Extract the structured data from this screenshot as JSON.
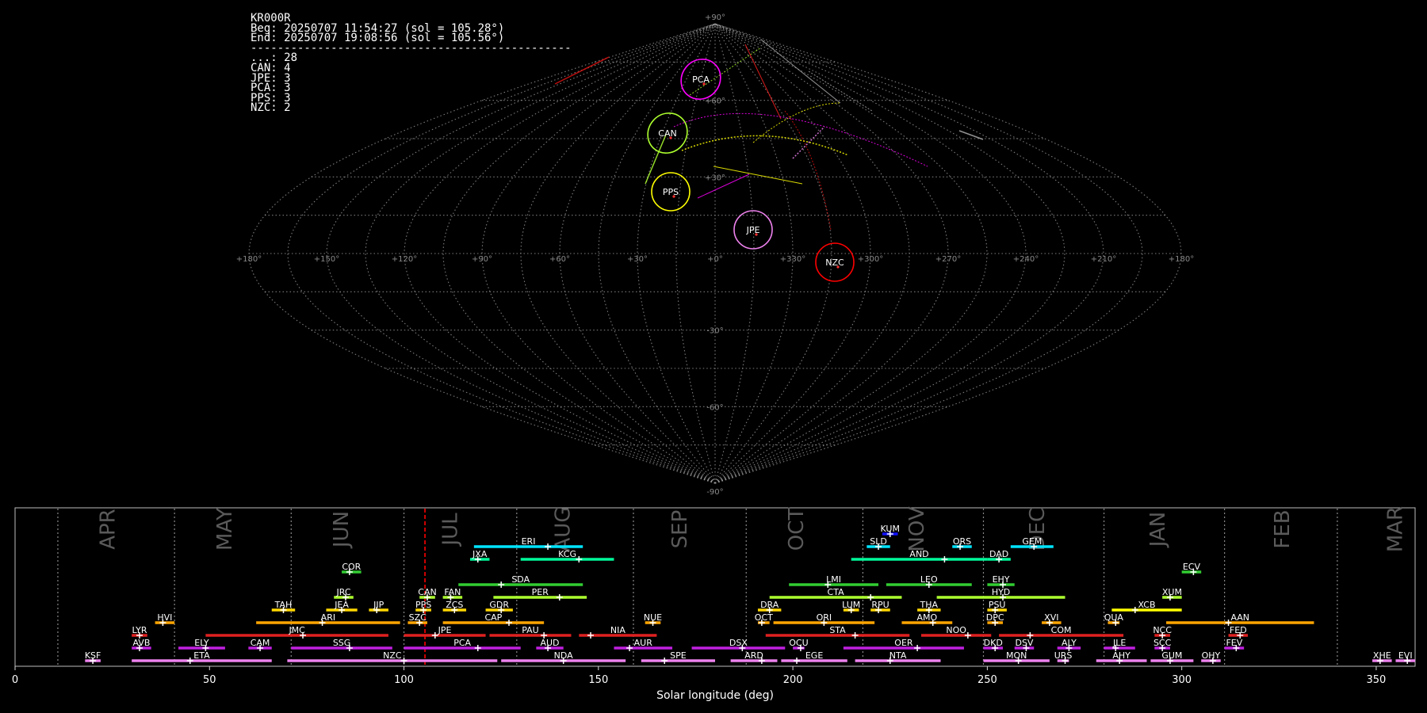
{
  "station_info": {
    "code": "KR000R",
    "beg": "Beg: 20250707 11:54:27 (sol = 105.28°)",
    "end": "End: 20250707 19:08:56 (sol = 105.56°)",
    "separator": "------------------------------------------------",
    "counts": [
      "...: 28",
      "CAN: 4",
      "JPE: 3",
      "PCA: 3",
      "PPS: 3",
      "NZC: 2"
    ]
  },
  "colors": {
    "background": "#000000",
    "grid": "#9a9a9a",
    "current_sol_marker": "#ff0000",
    "CAN": "#adff2f",
    "PCA": "#ff00ff",
    "PPS": "#ffff00",
    "JPE": "#ee82ee",
    "NZC": "#ff0000"
  },
  "skymap": {
    "projection": "sinusoidal",
    "lon_labels": [
      "+180°",
      "+150°",
      "+120°",
      "+90°",
      "+60°",
      "+30°",
      "+0°",
      "+330°",
      "+300°",
      "+270°",
      "+240°",
      "+210°",
      "+180°"
    ],
    "lat_labels": [
      "+90°",
      "+60°",
      "+30°",
      "-30°",
      "-60°",
      "-90°"
    ],
    "lat_values": [
      90,
      60,
      30,
      -30,
      -60,
      -90
    ],
    "showers": [
      {
        "code": "PCA",
        "lon": -5,
        "lat": 63,
        "color": "#ff00ff"
      },
      {
        "code": "CAN",
        "lon": -15,
        "lat": 48,
        "color": "#adff2f"
      },
      {
        "code": "PPS",
        "lon": -18,
        "lat": 31,
        "color": "#ffff00"
      },
      {
        "code": "JPE",
        "lon": -25,
        "lat": 20,
        "color": "#ee82ee"
      },
      {
        "code": "NZC",
        "lon": -63,
        "lat": -3,
        "color": "#ff0000"
      }
    ]
  },
  "chart_data": {
    "type": "timeline",
    "xlabel": "Solar longitude (deg)",
    "xlim": [
      0,
      360
    ],
    "xticks": [
      0,
      50,
      100,
      150,
      200,
      250,
      300,
      350
    ],
    "current_sol": 105.4,
    "month_labels": [
      {
        "label": "APR",
        "x": 24
      },
      {
        "label": "MAY",
        "x": 54
      },
      {
        "label": "JUN",
        "x": 84
      },
      {
        "label": "JUL",
        "x": 112
      },
      {
        "label": "AUG",
        "x": 141
      },
      {
        "label": "SEP",
        "x": 171
      },
      {
        "label": "OCT",
        "x": 201
      },
      {
        "label": "NOV",
        "x": 232
      },
      {
        "label": "DEC",
        "x": 263
      },
      {
        "label": "JAN",
        "x": 294
      },
      {
        "label": "FEB",
        "x": 326
      },
      {
        "label": "MAR",
        "x": 355
      }
    ],
    "month_boundaries": [
      11,
      41,
      71,
      100,
      129,
      159,
      188,
      218,
      249,
      280,
      311,
      340
    ],
    "showers": [
      {
        "code": "KSF",
        "start": 18,
        "end": 22,
        "peak": 20,
        "row": 0,
        "color": "#ee82ee"
      },
      {
        "code": "ETA",
        "start": 30,
        "end": 66,
        "peak": 45,
        "row": 0,
        "color": "#ee82ee"
      },
      {
        "code": "NZC",
        "start": 70,
        "end": 124,
        "peak": 100,
        "row": 0,
        "color": "#ee82ee"
      },
      {
        "code": "NDA",
        "start": 125,
        "end": 157,
        "peak": 141,
        "row": 0,
        "color": "#ee82ee"
      },
      {
        "code": "SPE",
        "start": 161,
        "end": 180,
        "peak": 167,
        "row": 0,
        "color": "#ee82ee"
      },
      {
        "code": "ARD",
        "start": 184,
        "end": 196,
        "peak": 192,
        "row": 0,
        "color": "#ee82ee"
      },
      {
        "code": "EGE",
        "start": 197,
        "end": 214,
        "peak": 201,
        "row": 0,
        "color": "#ee82ee"
      },
      {
        "code": "NTA",
        "start": 216,
        "end": 238,
        "peak": 225,
        "row": 0,
        "color": "#ee82ee"
      },
      {
        "code": "MON",
        "start": 249,
        "end": 266,
        "peak": 258,
        "row": 0,
        "color": "#ee82ee"
      },
      {
        "code": "URS",
        "start": 268,
        "end": 271,
        "peak": 270,
        "row": 0,
        "color": "#ee82ee"
      },
      {
        "code": "AHY",
        "start": 278,
        "end": 291,
        "peak": 284,
        "row": 0,
        "color": "#ee82ee"
      },
      {
        "code": "GUM",
        "start": 292,
        "end": 303,
        "peak": 297,
        "row": 0,
        "color": "#ee82ee"
      },
      {
        "code": "OHY",
        "start": 305,
        "end": 310,
        "peak": 308,
        "row": 0,
        "color": "#ee82ee"
      },
      {
        "code": "XHE",
        "start": 349,
        "end": 354,
        "peak": 351,
        "row": 0,
        "color": "#ee82ee"
      },
      {
        "code": "EVI",
        "start": 355,
        "end": 360,
        "peak": 358,
        "row": 0,
        "color": "#ee82ee"
      },
      {
        "code": "AVB",
        "start": 30,
        "end": 35,
        "peak": 32,
        "row": 1,
        "color": "#c020e0"
      },
      {
        "code": "ELY",
        "start": 42,
        "end": 54,
        "peak": 49,
        "row": 1,
        "color": "#c020e0"
      },
      {
        "code": "CAM",
        "start": 60,
        "end": 66,
        "peak": 63,
        "row": 1,
        "color": "#c020e0"
      },
      {
        "code": "SSG",
        "start": 71,
        "end": 97,
        "peak": 86,
        "row": 1,
        "color": "#c020e0"
      },
      {
        "code": "PCA",
        "start": 100,
        "end": 130,
        "peak": 119,
        "row": 1,
        "color": "#c020e0"
      },
      {
        "code": "AUD",
        "start": 134,
        "end": 141,
        "peak": 137,
        "row": 1,
        "color": "#c020e0"
      },
      {
        "code": "AUR",
        "start": 154,
        "end": 169,
        "peak": 158,
        "row": 1,
        "color": "#c020e0"
      },
      {
        "code": "DSX",
        "start": 174,
        "end": 198,
        "peak": 187,
        "row": 1,
        "color": "#c020e0"
      },
      {
        "code": "OCU",
        "start": 200,
        "end": 203,
        "peak": 202,
        "row": 1,
        "color": "#c020e0"
      },
      {
        "code": "OER",
        "start": 213,
        "end": 244,
        "peak": 232,
        "row": 1,
        "color": "#c020e0"
      },
      {
        "code": "DKD",
        "start": 249,
        "end": 254,
        "peak": 252,
        "row": 1,
        "color": "#c020e0"
      },
      {
        "code": "DSV",
        "start": 257,
        "end": 262,
        "peak": 260,
        "row": 1,
        "color": "#c020e0"
      },
      {
        "code": "ALY",
        "start": 268,
        "end": 274,
        "peak": 271,
        "row": 1,
        "color": "#c020e0"
      },
      {
        "code": "JLE",
        "start": 280,
        "end": 288,
        "peak": 283,
        "row": 1,
        "color": "#c020e0"
      },
      {
        "code": "SCC",
        "start": 293,
        "end": 297,
        "peak": 295,
        "row": 1,
        "color": "#c020e0"
      },
      {
        "code": "FEV",
        "start": 311,
        "end": 316,
        "peak": 314,
        "row": 1,
        "color": "#c020e0"
      },
      {
        "code": "LYR",
        "start": 30,
        "end": 34,
        "peak": 32,
        "row": 2,
        "color": "#e02020"
      },
      {
        "code": "JMC",
        "start": 49,
        "end": 96,
        "peak": 74,
        "row": 2,
        "color": "#e02020"
      },
      {
        "code": "JPE",
        "start": 100,
        "end": 121,
        "peak": 108,
        "row": 2,
        "color": "#e02020"
      },
      {
        "code": "PAU",
        "start": 122,
        "end": 143,
        "peak": 136,
        "row": 2,
        "color": "#e02020"
      },
      {
        "code": "NIA",
        "start": 145,
        "end": 165,
        "peak": 148,
        "row": 2,
        "color": "#e02020"
      },
      {
        "code": "STA",
        "start": 193,
        "end": 230,
        "peak": 216,
        "row": 2,
        "color": "#e02020"
      },
      {
        "code": "NOO",
        "start": 233,
        "end": 251,
        "peak": 245,
        "row": 2,
        "color": "#e02020"
      },
      {
        "code": "COM",
        "start": 253,
        "end": 285,
        "peak": 261,
        "row": 2,
        "color": "#e02020"
      },
      {
        "code": "NCC",
        "start": 293,
        "end": 297,
        "peak": 295,
        "row": 2,
        "color": "#e02020"
      },
      {
        "code": "FED",
        "start": 312,
        "end": 317,
        "peak": 315,
        "row": 2,
        "color": "#e02020"
      },
      {
        "code": "HVI",
        "start": 36,
        "end": 41,
        "peak": 38,
        "row": 3,
        "color": "#ffa500"
      },
      {
        "code": "ARI",
        "start": 62,
        "end": 99,
        "peak": 79,
        "row": 3,
        "color": "#ffa500"
      },
      {
        "code": "SZC",
        "start": 101,
        "end": 106,
        "peak": 104,
        "row": 3,
        "color": "#ffa500"
      },
      {
        "code": "CAP",
        "start": 110,
        "end": 136,
        "peak": 127,
        "row": 3,
        "color": "#ffa500"
      },
      {
        "code": "NUE",
        "start": 162,
        "end": 166,
        "peak": 164,
        "row": 3,
        "color": "#ffa500"
      },
      {
        "code": "OCT",
        "start": 191,
        "end": 194,
        "peak": 192,
        "row": 3,
        "color": "#ffa500"
      },
      {
        "code": "ORI",
        "start": 195,
        "end": 221,
        "peak": 208,
        "row": 3,
        "color": "#ffa500"
      },
      {
        "code": "AMO",
        "start": 228,
        "end": 241,
        "peak": 236,
        "row": 3,
        "color": "#ffa500"
      },
      {
        "code": "DPC",
        "start": 250,
        "end": 254,
        "peak": 252,
        "row": 3,
        "color": "#ffa500"
      },
      {
        "code": "XVI",
        "start": 264,
        "end": 269,
        "peak": 266,
        "row": 3,
        "color": "#ffa500"
      },
      {
        "code": "QUA",
        "start": 281,
        "end": 284,
        "peak": 283,
        "row": 3,
        "color": "#ffa500"
      },
      {
        "code": "AAN",
        "start": 296,
        "end": 334,
        "peak": 312,
        "row": 3,
        "color": "#ffa500"
      },
      {
        "code": "TAH",
        "start": 66,
        "end": 72,
        "peak": 69,
        "row": 4,
        "color": "#ffd700"
      },
      {
        "code": "JEA",
        "start": 80,
        "end": 88,
        "peak": 84,
        "row": 4,
        "color": "#ffd700"
      },
      {
        "code": "JIP",
        "start": 91,
        "end": 96,
        "peak": 93,
        "row": 4,
        "color": "#ffd700"
      },
      {
        "code": "PPS",
        "start": 103,
        "end": 107,
        "peak": 105,
        "row": 4,
        "color": "#ffd700"
      },
      {
        "code": "ZCS",
        "start": 110,
        "end": 116,
        "peak": 113,
        "row": 4,
        "color": "#ffd700"
      },
      {
        "code": "GDR",
        "start": 121,
        "end": 128,
        "peak": 125,
        "row": 4,
        "color": "#ffd700"
      },
      {
        "code": "DRA",
        "start": 191,
        "end": 197,
        "peak": 194,
        "row": 4,
        "color": "#ffd700"
      },
      {
        "code": "LUM",
        "start": 213,
        "end": 217,
        "peak": 215,
        "row": 4,
        "color": "#ffd700"
      },
      {
        "code": "RPU",
        "start": 220,
        "end": 225,
        "peak": 222,
        "row": 4,
        "color": "#ffd700"
      },
      {
        "code": "THA",
        "start": 232,
        "end": 238,
        "peak": 235,
        "row": 4,
        "color": "#ffd700"
      },
      {
        "code": "PSU",
        "start": 250,
        "end": 255,
        "peak": 252,
        "row": 4,
        "color": "#ffd700"
      },
      {
        "code": "XCB",
        "start": 282,
        "end": 300,
        "peak": 288,
        "row": 4,
        "color": "#ffff00"
      },
      {
        "code": "JRC",
        "start": 82,
        "end": 87,
        "peak": 85,
        "row": 5,
        "color": "#adff2f"
      },
      {
        "code": "CAN",
        "start": 104,
        "end": 108,
        "peak": 106,
        "row": 5,
        "color": "#adff2f"
      },
      {
        "code": "FAN",
        "start": 110,
        "end": 115,
        "peak": 112,
        "row": 5,
        "color": "#adff2f"
      },
      {
        "code": "PER",
        "start": 123,
        "end": 147,
        "peak": 140,
        "row": 5,
        "color": "#adff2f"
      },
      {
        "code": "CTA",
        "start": 194,
        "end": 228,
        "peak": 220,
        "row": 5,
        "color": "#adff2f"
      },
      {
        "code": "HYD",
        "start": 237,
        "end": 270,
        "peak": 254,
        "row": 5,
        "color": "#adff2f"
      },
      {
        "code": "XUM",
        "start": 295,
        "end": 300,
        "peak": 297,
        "row": 5,
        "color": "#adff2f"
      },
      {
        "code": "SDA",
        "start": 114,
        "end": 146,
        "peak": 125,
        "row": 6,
        "color": "#32cd32"
      },
      {
        "code": "LMI",
        "start": 199,
        "end": 222,
        "peak": 209,
        "row": 6,
        "color": "#32cd32"
      },
      {
        "code": "LEO",
        "start": 224,
        "end": 246,
        "peak": 235,
        "row": 6,
        "color": "#32cd32"
      },
      {
        "code": "EHY",
        "start": 250,
        "end": 257,
        "peak": 254,
        "row": 6,
        "color": "#32cd32"
      },
      {
        "code": "COR",
        "start": 84,
        "end": 89,
        "peak": 86,
        "row": 7,
        "color": "#32cd32"
      },
      {
        "code": "ECV",
        "start": 300,
        "end": 305,
        "peak": 303,
        "row": 7,
        "color": "#32cd32"
      },
      {
        "code": "JXA",
        "start": 117,
        "end": 122,
        "peak": 119,
        "row": 8,
        "color": "#00fa9a"
      },
      {
        "code": "KCG",
        "start": 130,
        "end": 154,
        "peak": 145,
        "row": 8,
        "color": "#00fa9a"
      },
      {
        "code": "AND",
        "start": 215,
        "end": 250,
        "peak": 239,
        "row": 8,
        "color": "#00fa9a"
      },
      {
        "code": "DAD",
        "start": 250,
        "end": 256,
        "peak": 253,
        "row": 8,
        "color": "#00fa9a"
      },
      {
        "code": "ERI",
        "start": 118,
        "end": 146,
        "peak": 137,
        "row": 9,
        "color": "#00e5ff"
      },
      {
        "code": "SLD",
        "start": 219,
        "end": 225,
        "peak": 222,
        "row": 9,
        "color": "#00e5ff"
      },
      {
        "code": "ORS",
        "start": 241,
        "end": 246,
        "peak": 243,
        "row": 9,
        "color": "#00e5ff"
      },
      {
        "code": "GEM",
        "start": 256,
        "end": 267,
        "peak": 262,
        "row": 9,
        "color": "#00e5ff"
      },
      {
        "code": "KUM",
        "start": 223,
        "end": 227,
        "peak": 225,
        "row": 10,
        "color": "#1010ff"
      }
    ]
  }
}
